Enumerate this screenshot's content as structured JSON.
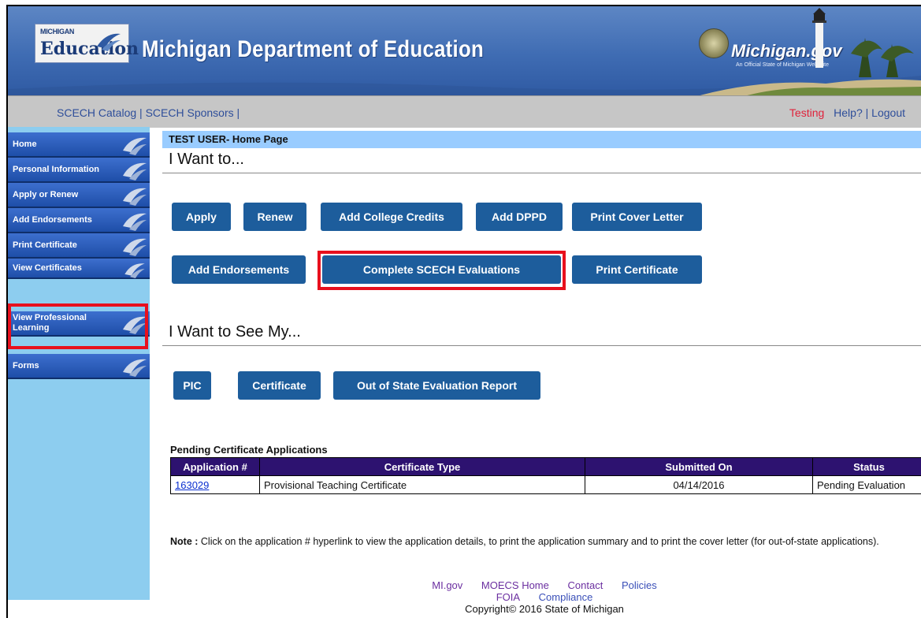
{
  "header": {
    "logo_small": "MICHIGAN",
    "logo_big": "Education",
    "title": "Michigan Department of Education",
    "michigan_gov": "Michigan.gov",
    "michigan_gov_sub": "An Official State of Michigan Web Site"
  },
  "subnav": {
    "links": [
      "SCECH Catalog",
      "SCECH Sponsors"
    ],
    "testing": "Testing",
    "help": "Help?",
    "logout": "Logout"
  },
  "sidebar": {
    "items": [
      {
        "label": "Home"
      },
      {
        "label": "Personal Information"
      },
      {
        "label": "Apply or Renew"
      },
      {
        "label": "Add Endorsements"
      },
      {
        "label": "Print Certificate"
      },
      {
        "label": "View Certificates"
      },
      {
        "label": "View Professional Learning"
      },
      {
        "label": "Forms"
      }
    ]
  },
  "main": {
    "page_title": "TEST USER- Home Page",
    "want_to": "I Want to...",
    "buttons_row1": [
      "Apply",
      "Renew",
      "Add College Credits",
      "Add DPPD",
      "Print Cover Letter"
    ],
    "buttons_row2": [
      "Add Endorsements",
      "Complete SCECH Evaluations",
      "Print Certificate"
    ],
    "want_to_see": "I Want to See My...",
    "buttons_row3": [
      "PIC",
      "Certificate",
      "Out of State Evaluation Report"
    ]
  },
  "pending": {
    "title": "Pending Certificate Applications",
    "headers": [
      "Application #",
      "Certificate Type",
      "Submitted On",
      "Status"
    ],
    "rows": [
      [
        "163029",
        "Provisional Teaching Certificate",
        "04/14/2016",
        "Pending Evaluation"
      ]
    ]
  },
  "note": {
    "label": "Note :",
    "text": " Click on the application # hyperlink to view the application details, to print the application summary and to print the cover letter (for out-of-state applications)."
  },
  "footer": {
    "links_row1": [
      "MI.gov",
      "MOECS Home",
      "Contact",
      "Policies"
    ],
    "links_row2": [
      "FOIA",
      "Compliance"
    ],
    "copyright": "Copyright© 2016 State of Michigan"
  },
  "colors": {
    "header_blue": "#3f6cb3",
    "button_blue": "#1d5d9c",
    "table_header": "#2d1270",
    "highlight_red": "#e8101d",
    "sidebar_bg": "#8dcdef"
  }
}
